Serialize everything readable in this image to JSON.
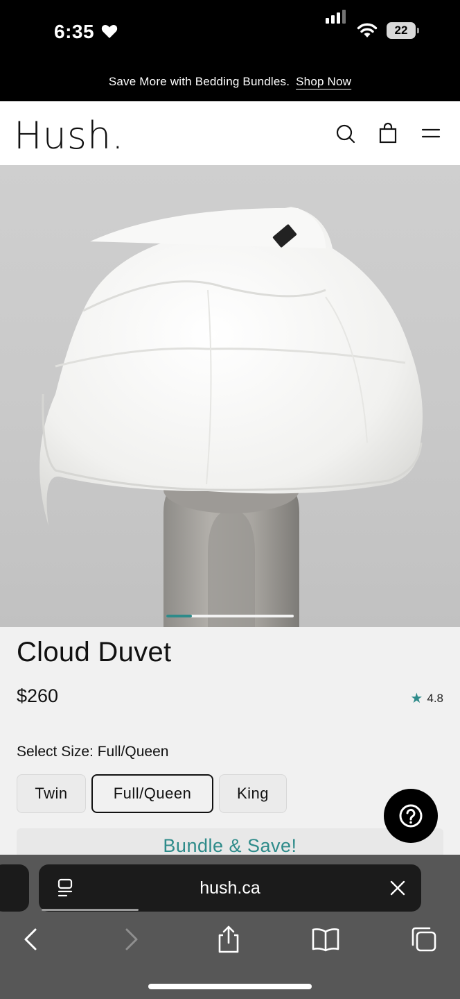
{
  "status_bar": {
    "time": "6:35",
    "battery": "22",
    "icons": [
      "heart-icon",
      "cellular-signal-icon",
      "wifi-icon",
      "battery-icon"
    ]
  },
  "promo": {
    "text": "Save More with Bedding Bundles.",
    "link": "Shop Now"
  },
  "header": {
    "logo": "Hush.",
    "icons": [
      "search-icon",
      "shopping-bag-icon",
      "menu-icon"
    ]
  },
  "hero": {
    "carousel_progress": 0.2
  },
  "product": {
    "title": "Cloud Duvet",
    "price": "$260",
    "rating": "4.8",
    "size_label": "Select Size: Full/Queen",
    "sizes": [
      "Twin",
      "Full/Queen",
      "King"
    ],
    "selected_size": "Full/Queen",
    "bundle_cta": "Bundle & Save!"
  },
  "browser": {
    "url": "hush.ca",
    "toolbar": [
      "back-icon",
      "forward-icon",
      "share-icon",
      "bookmarks-icon",
      "tabs-icon"
    ]
  },
  "colors": {
    "accent": "#2e8b8a",
    "promo_bg": "#000000",
    "page_bg": "#f1f1f1"
  }
}
